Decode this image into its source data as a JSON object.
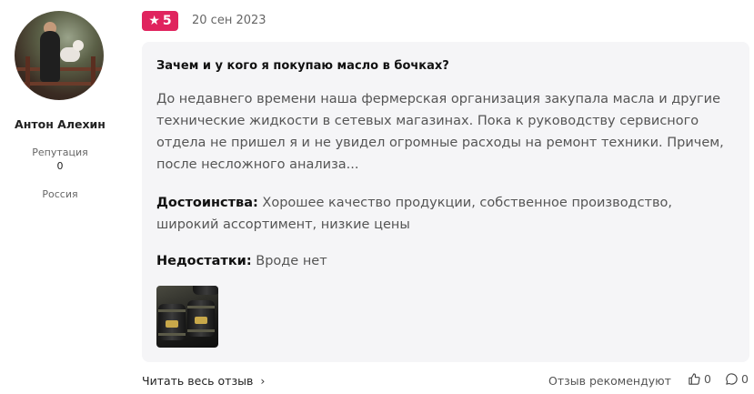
{
  "reviewer": {
    "name": "Антон Алехин",
    "reputation_label": "Репутация",
    "reputation_value": "0",
    "country": "Россия"
  },
  "review": {
    "rating": "5",
    "date": "20 сен 2023",
    "title": "Зачем и у кого я покупаю масло в бочках?",
    "excerpt": "До недавнего времени наша фермерская организация закупала масла и другие технические жидкости в сетевых магазинах. Пока к руководству сервисного отдела не пришел я и не увидел огромные расходы на ремонт техники. Причем, после несложного анализа...",
    "pros_label": "Достоинства:",
    "pros_text": " Хорошее качество продукции, собственное производство, широкий ассортимент, низкие цены",
    "cons_label": "Недостатки:",
    "cons_text": " Вроде нет"
  },
  "footer": {
    "read_more": "Читать весь отзыв",
    "recommend_label": "Отзыв рекомендуют",
    "likes_count": "0",
    "comments_count": "0"
  },
  "colors": {
    "accent": "#e0245e",
    "card_bg": "#f5f5f7"
  },
  "icons": {
    "rating": "star-icon",
    "read_more": "chevron-right-icon",
    "likes": "thumbs-up-icon",
    "comments": "comment-icon"
  }
}
